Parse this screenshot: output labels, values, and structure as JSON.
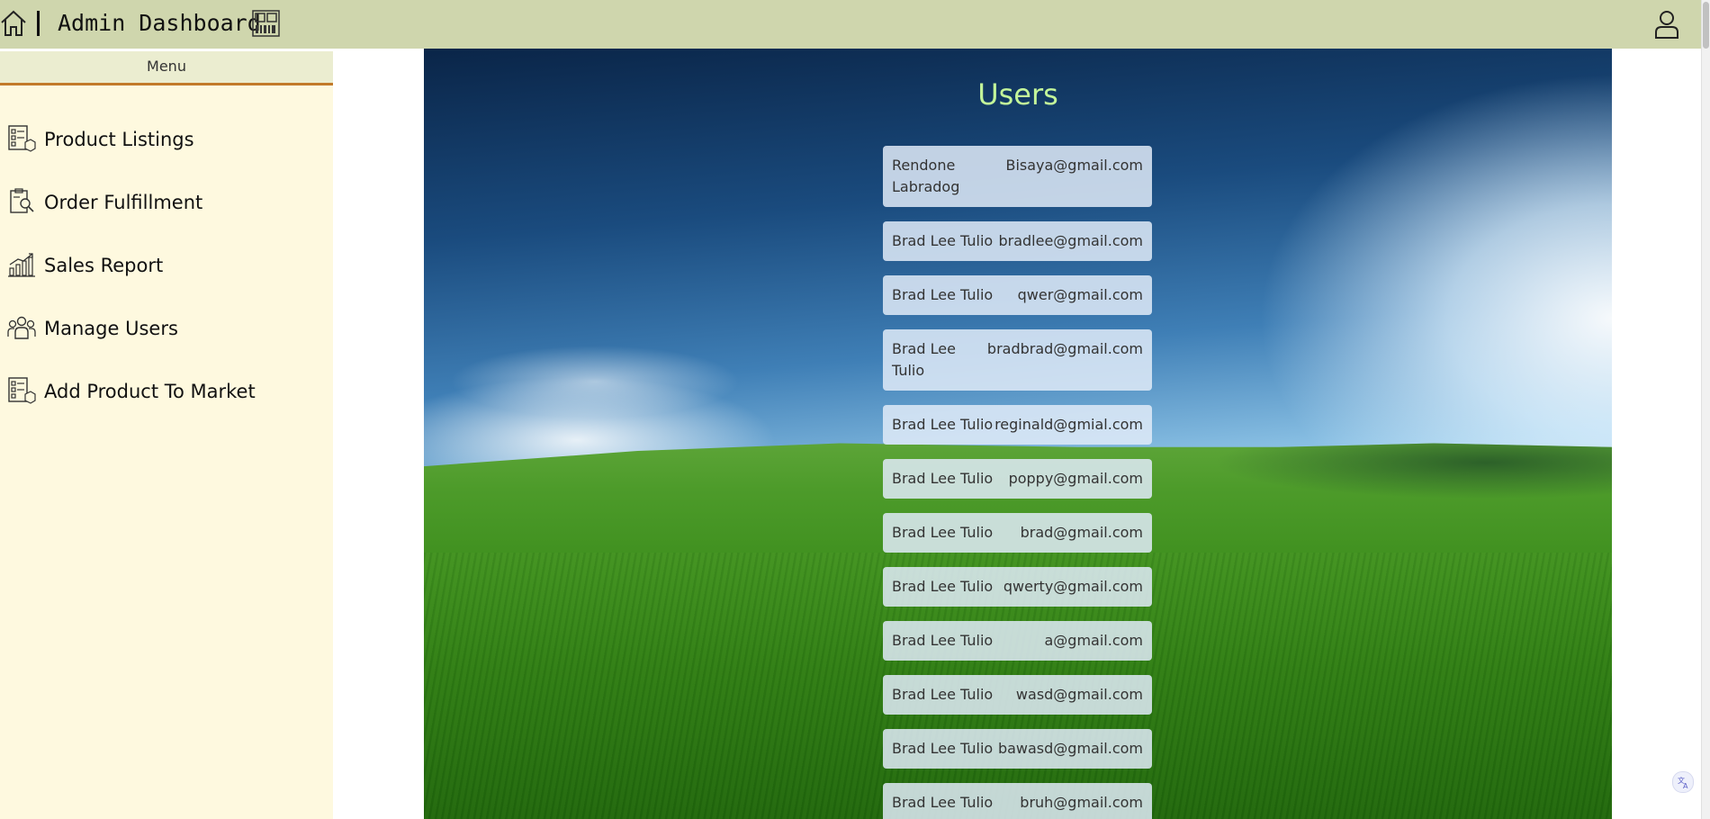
{
  "header": {
    "title": "Admin Dashboard",
    "home_icon": "home-icon",
    "logo_icon": "barcode-logo-icon",
    "user_icon": "user-profile-icon"
  },
  "sidebar": {
    "menu_title": "Menu",
    "items": [
      {
        "label": "Product Listings",
        "icon": "checklist-box-icon"
      },
      {
        "label": "Order Fulfillment",
        "icon": "clipboard-search-icon"
      },
      {
        "label": "Sales Report",
        "icon": "growth-chart-icon"
      },
      {
        "label": "Manage Users",
        "icon": "user-group-icon"
      },
      {
        "label": "Add Product To Market",
        "icon": "checklist-box-icon"
      }
    ]
  },
  "main": {
    "title": "Users",
    "users": [
      {
        "name": "Rendone Labradog",
        "email": "Bisaya@gmail.com"
      },
      {
        "name": "Brad Lee Tulio",
        "email": "bradlee@gmail.com"
      },
      {
        "name": "Brad Lee Tulio",
        "email": "qwer@gmail.com"
      },
      {
        "name": "Brad Lee Tulio",
        "email": "bradbrad@gmail.com"
      },
      {
        "name": "Brad Lee Tulio",
        "email": "reginald@gmial.com"
      },
      {
        "name": "Brad Lee Tulio",
        "email": "poppy@gmail.com"
      },
      {
        "name": "Brad Lee Tulio",
        "email": "brad@gmail.com"
      },
      {
        "name": "Brad Lee Tulio",
        "email": "qwerty@gmail.com"
      },
      {
        "name": "Brad Lee Tulio",
        "email": "a@gmail.com"
      },
      {
        "name": "Brad Lee Tulio",
        "email": "wasd@gmail.com"
      },
      {
        "name": "Brad Lee Tulio",
        "email": "bawasd@gmail.com"
      },
      {
        "name": "Brad Lee Tulio",
        "email": "bruh@gmail.com"
      }
    ]
  },
  "colors": {
    "topbar": "#cfd6ad",
    "sidebar": "#fef9df",
    "menu_underline": "#c27a2b",
    "users_title": "#c3f59a"
  }
}
